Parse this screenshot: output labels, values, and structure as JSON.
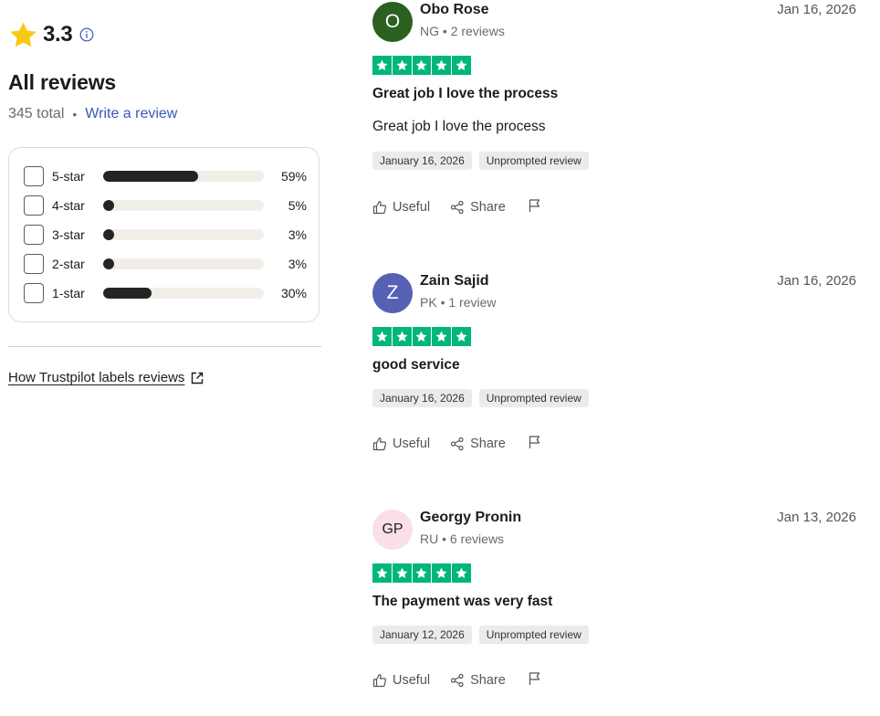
{
  "summary": {
    "rating": "3.3",
    "heading": "All reviews",
    "total": "345 total",
    "separator": "•",
    "write_review": "Write a review",
    "star_color": "#f8c910"
  },
  "distribution": [
    {
      "label": "5-star",
      "percent_text": "59%",
      "fill": 0.59
    },
    {
      "label": "4-star",
      "percent_text": "5%",
      "fill": 0.05
    },
    {
      "label": "3-star",
      "percent_text": "3%",
      "fill": 0.03
    },
    {
      "label": "2-star",
      "percent_text": "3%",
      "fill": 0.03
    },
    {
      "label": "1-star",
      "percent_text": "30%",
      "fill": 0.3
    }
  ],
  "labels_link": "How Trustpilot labels reviews",
  "trust_green": "#00b67a",
  "reviews": [
    {
      "initials": "O",
      "avatar_bg": "#2b6020",
      "avatar_fg": "#ffffff",
      "name": "Obo Rose",
      "country": "NG",
      "count": "2 reviews",
      "date": "Jan 16, 2026",
      "stars": 5,
      "title": "Great job I love the process",
      "body": "Great job I love the process",
      "experience_date": "January 16, 2026",
      "tag": "Unprompted review",
      "useful": "Useful",
      "share": "Share"
    },
    {
      "initials": "Z",
      "avatar_bg": "#5661b3",
      "avatar_fg": "#ffffff",
      "name": "Zain Sajid",
      "country": "PK",
      "count": "1 review",
      "date": "Jan 16, 2026",
      "stars": 5,
      "title": "good service",
      "body": "",
      "experience_date": "January 16, 2026",
      "tag": "Unprompted review",
      "useful": "Useful",
      "share": "Share"
    },
    {
      "initials": "GP",
      "avatar_bg": "#fbdfe6",
      "avatar_fg": "#1c1c1c",
      "name": "Georgy Pronin",
      "country": "RU",
      "count": "6 reviews",
      "date": "Jan 13, 2026",
      "stars": 5,
      "title": "The payment was very fast",
      "body": "",
      "experience_date": "January 12, 2026",
      "tag": "Unprompted review",
      "useful": "Useful",
      "share": "Share"
    }
  ],
  "icons": {
    "rating": "star-icon",
    "info": "info-icon",
    "external": "external-link-icon",
    "useful": "thumbs-up-icon",
    "share": "share-icon",
    "report": "flag-icon"
  }
}
